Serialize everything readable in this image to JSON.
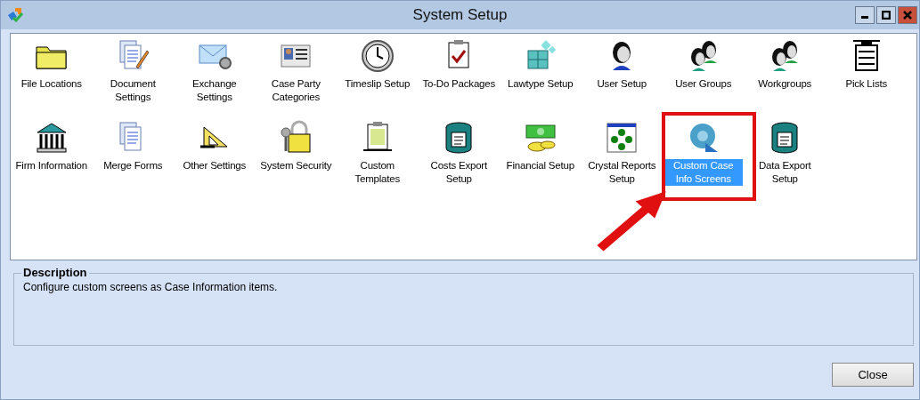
{
  "window": {
    "title": "System Setup"
  },
  "items": [
    {
      "label": "File Locations",
      "selected": false
    },
    {
      "label": "Document Settings",
      "selected": false
    },
    {
      "label": "Exchange Settings",
      "selected": false
    },
    {
      "label": "Case Party Categories",
      "selected": false
    },
    {
      "label": "Timeslip Setup",
      "selected": false
    },
    {
      "label": "To-Do Packages",
      "selected": false
    },
    {
      "label": "Lawtype Setup",
      "selected": false
    },
    {
      "label": "User Setup",
      "selected": false
    },
    {
      "label": "User Groups",
      "selected": false
    },
    {
      "label": "Workgroups",
      "selected": false
    },
    {
      "label": "Pick Lists",
      "selected": false
    },
    {
      "label": "Firm Information",
      "selected": false
    },
    {
      "label": "Merge Forms",
      "selected": false
    },
    {
      "label": "Other Settings",
      "selected": false
    },
    {
      "label": "System Security",
      "selected": false
    },
    {
      "label": "Custom Templates",
      "selected": false
    },
    {
      "label": "Costs Export Setup",
      "selected": false
    },
    {
      "label": "Financial Setup",
      "selected": false
    },
    {
      "label": "Crystal Reports Setup",
      "selected": false
    },
    {
      "label": "Custom Case Info Screens",
      "selected": true
    },
    {
      "label": "Data Export Setup",
      "selected": false
    }
  ],
  "description": {
    "legend": "Description",
    "text": "Configure custom screens as Case Information items."
  },
  "buttons": [
    "Close"
  ]
}
